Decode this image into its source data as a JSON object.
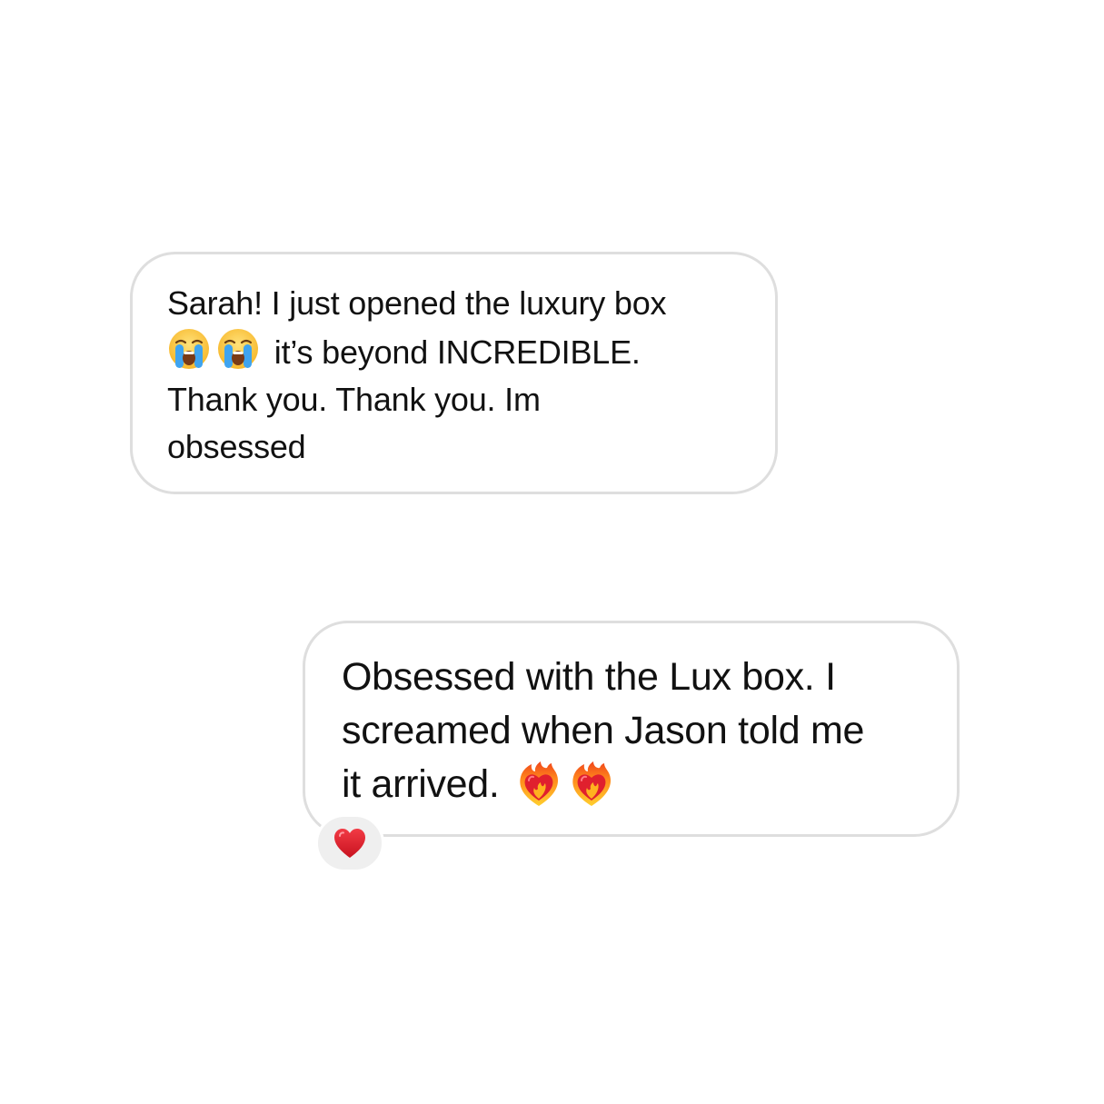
{
  "messages": [
    {
      "direction": "received",
      "parts": {
        "line1": "Sarah! I just opened the luxury box",
        "emoji_1": "crying-face-icon",
        "emoji_2": "crying-face-icon",
        "line2": " it’s beyond INCREDIBLE.",
        "line3": "Thank you. Thank you. Im",
        "line4": "obsessed"
      }
    },
    {
      "direction": "sent",
      "parts": {
        "line1": "Obsessed with the Lux box. I",
        "line2": "screamed when Jason told me",
        "line3": "it arrived. ",
        "emoji_1": "heart-on-fire-icon",
        "emoji_2": "heart-on-fire-icon"
      },
      "reaction": "red-heart-icon"
    }
  ],
  "colors": {
    "bubble_border": "#dedede",
    "reaction_bg": "#efefef",
    "text": "#111111",
    "heart_red": "#e0202e"
  }
}
